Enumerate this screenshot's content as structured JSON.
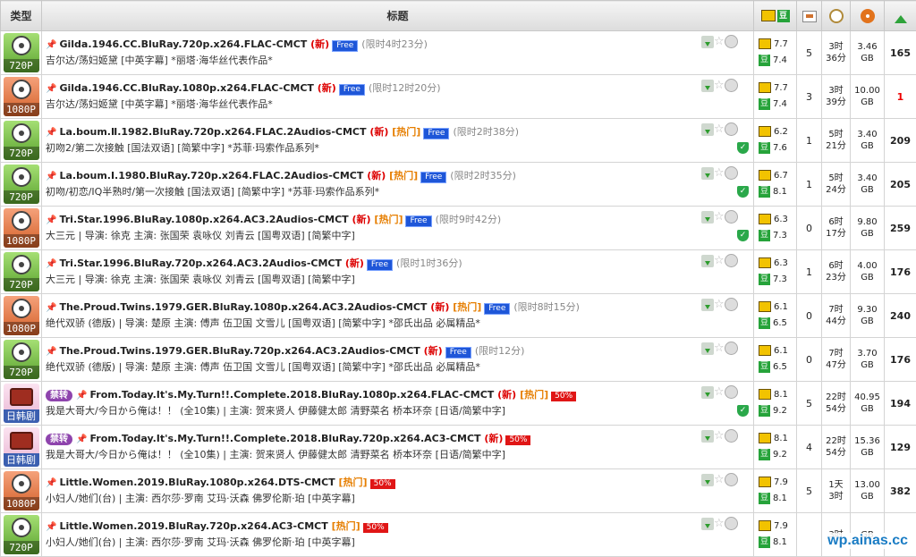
{
  "header": {
    "type": "类型",
    "title": "标题",
    "dou_glyph": "豆"
  },
  "rows": [
    {
      "cat": "720P",
      "cls": "c720",
      "name": "Gilda.1946.CC.BluRay.720p.x264.FLAC-CMCT",
      "tag": "",
      "new": "(新)",
      "hot": "",
      "promo": "Free",
      "promo_type": "free",
      "remain": "(限时4时23分)",
      "sub": "吉尔达/荡妇姬黛 [中英字幕] *丽塔·海华丝代表作品*",
      "imdb": "7.7",
      "douban": "7.4",
      "comments": "5",
      "time1": "3时",
      "time2": "36分",
      "size1": "3.46",
      "size2": "GB",
      "seeders": "165",
      "seed_red": false,
      "shield": false
    },
    {
      "cat": "1080P",
      "cls": "c1080",
      "name": "Gilda.1946.CC.BluRay.1080p.x264.FLAC-CMCT",
      "tag": "",
      "new": "(新)",
      "hot": "",
      "promo": "Free",
      "promo_type": "free",
      "remain": "(限时12时20分)",
      "sub": "吉尔达/荡妇姬黛 [中英字幕] *丽塔·海华丝代表作品*",
      "imdb": "7.7",
      "douban": "7.4",
      "comments": "3",
      "time1": "3时",
      "time2": "39分",
      "size1": "10.00",
      "size2": "GB",
      "seeders": "1",
      "seed_red": true,
      "shield": false
    },
    {
      "cat": "720P",
      "cls": "c720",
      "name": "La.boum.Ⅱ.1982.BluRay.720p.x264.FLAC.2Audios-CMCT",
      "tag": "",
      "new": "(新)",
      "hot": "[热门]",
      "promo": "Free",
      "promo_type": "free",
      "remain": "(限时2时38分)",
      "sub": "初吻2/第二次接触 [国法双语] [简繁中字] *苏菲·玛索作品系列*",
      "imdb": "6.2",
      "douban": "7.6",
      "comments": "1",
      "time1": "5时",
      "time2": "21分",
      "size1": "3.40",
      "size2": "GB",
      "seeders": "209",
      "seed_red": false,
      "shield": true
    },
    {
      "cat": "720P",
      "cls": "c720",
      "name": "La.boum.Ⅰ.1980.BluRay.720p.x264.FLAC.2Audios-CMCT",
      "tag": "",
      "new": "(新)",
      "hot": "[热门]",
      "promo": "Free",
      "promo_type": "free",
      "remain": "(限时2时35分)",
      "sub": "初吻/初恋/IQ半熟时/第一次接触 [国法双语] [简繁中字] *苏菲·玛索作品系列*",
      "imdb": "6.7",
      "douban": "8.1",
      "comments": "1",
      "time1": "5时",
      "time2": "24分",
      "size1": "3.40",
      "size2": "GB",
      "seeders": "205",
      "seed_red": false,
      "shield": true
    },
    {
      "cat": "1080P",
      "cls": "c1080",
      "name": "Tri.Star.1996.BluRay.1080p.x264.AC3.2Audios-CMCT",
      "tag": "",
      "new": "(新)",
      "hot": "[热门]",
      "promo": "Free",
      "promo_type": "free",
      "remain": "(限时9时42分)",
      "sub": "大三元 | 导演: 徐克 主演: 张国荣 袁咏仪 刘青云 [国粤双语] [简繁中字]",
      "imdb": "6.3",
      "douban": "7.3",
      "comments": "0",
      "time1": "6时",
      "time2": "17分",
      "size1": "9.80",
      "size2": "GB",
      "seeders": "259",
      "seed_red": false,
      "shield": true
    },
    {
      "cat": "720P",
      "cls": "c720",
      "name": "Tri.Star.1996.BluRay.720p.x264.AC3.2Audios-CMCT",
      "tag": "",
      "new": "(新)",
      "hot": "",
      "promo": "Free",
      "promo_type": "free",
      "remain": "(限时1时36分)",
      "sub": "大三元 | 导演: 徐克 主演: 张国荣 袁咏仪 刘青云 [国粤双语] [简繁中字]",
      "imdb": "6.3",
      "douban": "7.3",
      "comments": "1",
      "time1": "6时",
      "time2": "23分",
      "size1": "4.00",
      "size2": "GB",
      "seeders": "176",
      "seed_red": false,
      "shield": false
    },
    {
      "cat": "1080P",
      "cls": "c1080",
      "name": "The.Proud.Twins.1979.GER.BluRay.1080p.x264.AC3.2Audios-CMCT",
      "tag": "",
      "new": "(新)",
      "hot": "[热门]",
      "promo": "Free",
      "promo_type": "free",
      "remain": "(限时8时15分)",
      "sub": "绝代双骄 (德版) | 导演: 楚原 主演: 傅声 伍卫国 文雪儿 [国粤双语] [简繁中字] *邵氏出品 必属精品*",
      "imdb": "6.1",
      "douban": "6.5",
      "comments": "0",
      "time1": "7时",
      "time2": "44分",
      "size1": "9.30",
      "size2": "GB",
      "seeders": "240",
      "seed_red": false,
      "shield": false
    },
    {
      "cat": "720P",
      "cls": "c720",
      "name": "The.Proud.Twins.1979.GER.BluRay.720p.x264.AC3.2Audios-CMCT",
      "tag": "",
      "new": "(新)",
      "hot": "",
      "promo": "Free",
      "promo_type": "free",
      "remain": "(限时12分)",
      "sub": "绝代双骄 (德版) | 导演: 楚原 主演: 傅声 伍卫国 文雪儿 [国粤双语] [简繁中字] *邵氏出品 必属精品*",
      "imdb": "6.1",
      "douban": "6.5",
      "comments": "0",
      "time1": "7时",
      "time2": "47分",
      "size1": "3.70",
      "size2": "GB",
      "seeders": "176",
      "seed_red": false,
      "shield": false
    },
    {
      "cat": "日韩剧",
      "cls": "ctv",
      "name": "From.Today.It's.My.Turn!!.Complete.2018.BluRay.1080p.x264.FLAC-CMCT",
      "tag": "禁转",
      "new": "(新)",
      "hot": "[热门]",
      "promo": "50%",
      "promo_type": "p50",
      "remain": "",
      "sub": "我是大哥大/今日から俺は！！ (全10集) | 主演: 贺来贤人 伊藤健太郎 清野菜名 桥本环奈 [日语/简繁中字]",
      "imdb": "8.1",
      "douban": "9.2",
      "comments": "5",
      "time1": "22时",
      "time2": "54分",
      "size1": "40.95",
      "size2": "GB",
      "seeders": "194",
      "seed_red": false,
      "shield": true
    },
    {
      "cat": "日韩剧",
      "cls": "ctv",
      "name": "From.Today.It's.My.Turn!!.Complete.2018.BluRay.720p.x264.AC3-CMCT",
      "tag": "禁转",
      "new": "(新)",
      "hot": "",
      "promo": "50%",
      "promo_type": "p50",
      "remain": "",
      "sub": "我是大哥大/今日から俺は！！ (全10集) | 主演: 贺来贤人 伊藤健太郎 清野菜名 桥本环奈 [日语/简繁中字]",
      "imdb": "8.1",
      "douban": "9.2",
      "comments": "4",
      "time1": "22时",
      "time2": "54分",
      "size1": "15.36",
      "size2": "GB",
      "seeders": "129",
      "seed_red": false,
      "shield": false
    },
    {
      "cat": "1080P",
      "cls": "c1080",
      "name": "Little.Women.2019.BluRay.1080p.x264.DTS-CMCT",
      "tag": "",
      "new": "",
      "hot": "[热门]",
      "promo": "50%",
      "promo_type": "p50",
      "remain": "",
      "sub": "小妇人/她们(台) | 主演: 西尔莎·罗南 艾玛·沃森 佛罗伦斯·珀 [中英字幕]",
      "imdb": "7.9",
      "douban": "8.1",
      "comments": "5",
      "time1": "1天",
      "time2": "3时",
      "size1": "13.00",
      "size2": "GB",
      "seeders": "382",
      "seed_red": false,
      "shield": false
    },
    {
      "cat": "720P",
      "cls": "c720",
      "name": "Little.Women.2019.BluRay.720p.x264.AC3-CMCT",
      "tag": "",
      "new": "",
      "hot": "[热门]",
      "promo": "50%",
      "promo_type": "p50",
      "remain": "",
      "sub": "小妇人/她们(台) | 主演: 西尔莎·罗南 艾玛·沃森 佛罗伦斯·珀 [中英字幕]",
      "imdb": "7.9",
      "douban": "8.1",
      "comments": "",
      "time1": "",
      "time2": "3时",
      "size1": "",
      "size2": "GB",
      "seeders": "",
      "seed_red": false,
      "shield": false
    }
  ],
  "watermark": "wp.ainas.cc"
}
